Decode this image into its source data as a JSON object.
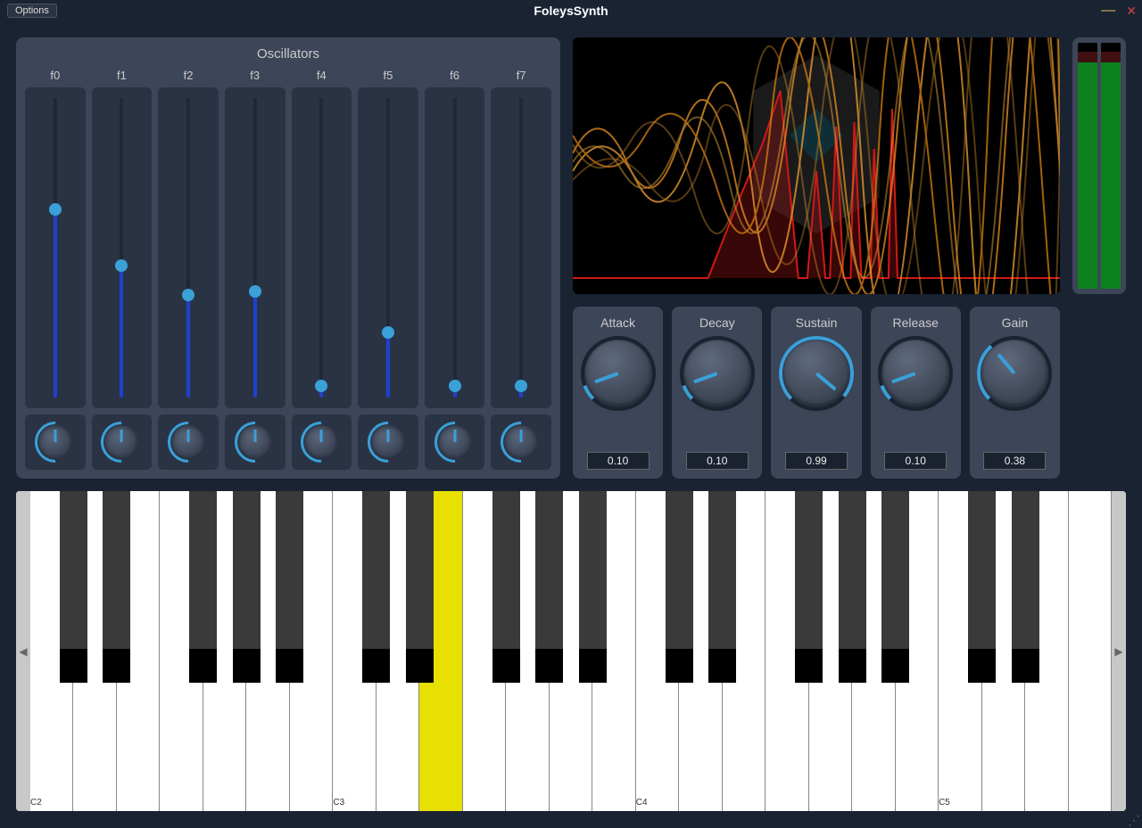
{
  "window": {
    "options_label": "Options",
    "title": "FoleysSynth"
  },
  "oscillators": {
    "title": "Oscillators",
    "cols": [
      {
        "label": "f0",
        "slider": 0.64
      },
      {
        "label": "f1",
        "slider": 0.45
      },
      {
        "label": "f2",
        "slider": 0.35
      },
      {
        "label": "f3",
        "slider": 0.36
      },
      {
        "label": "f4",
        "slider": 0.04
      },
      {
        "label": "f5",
        "slider": 0.22
      },
      {
        "label": "f6",
        "slider": 0.04
      },
      {
        "label": "f7",
        "slider": 0.04
      }
    ]
  },
  "envelope": [
    {
      "name": "Attack",
      "value": "0.10",
      "angle": -110
    },
    {
      "name": "Decay",
      "value": "0.10",
      "angle": -110
    },
    {
      "name": "Sustain",
      "value": "0.99",
      "angle": 130
    },
    {
      "name": "Release",
      "value": "0.10",
      "angle": -110
    },
    {
      "name": "Gain",
      "value": "0.38",
      "angle": -40
    }
  ],
  "meters": {
    "left": 0.93,
    "right": 0.93
  },
  "keyboard": {
    "white_count": 25,
    "pressed_white_index": 9,
    "labels": [
      {
        "idx": 0,
        "text": "C2"
      },
      {
        "idx": 7,
        "text": "C3"
      },
      {
        "idx": 14,
        "text": "C4"
      },
      {
        "idx": 21,
        "text": "C5"
      }
    ]
  }
}
